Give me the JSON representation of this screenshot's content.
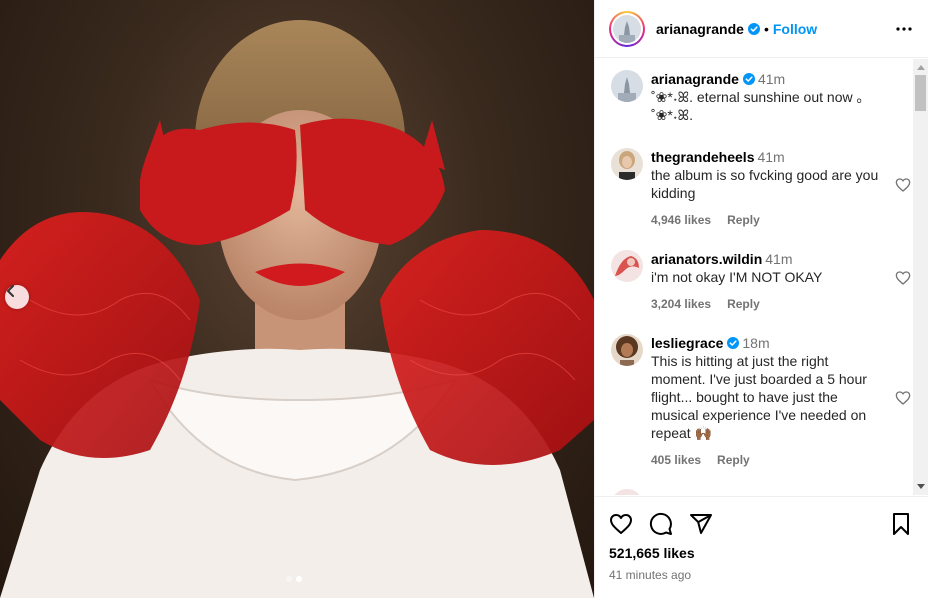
{
  "post": {
    "author": "arianagrande",
    "follow_label": "Follow",
    "separator": "•",
    "caption_time": "41m",
    "caption_text": "˚❀*˖ꕤ. eternal sunshine out now ｡ ˚❀*˖ꕤ.",
    "likes": "521,665 likes",
    "posted": "41 minutes ago"
  },
  "media": {
    "image_count": 2,
    "active_index": 1
  },
  "comments": [
    {
      "user": "thegrandeheels",
      "time": "41m",
      "text": "the album is so fvcking good are you kidding",
      "likes": "4,946 likes",
      "reply": "Reply",
      "verified": false
    },
    {
      "user": "arianators.wildin",
      "time": "41m",
      "text": "i'm not okay I'M NOT OKAY",
      "likes": "3,204 likes",
      "reply": "Reply",
      "verified": false
    },
    {
      "user": "lesliegrace",
      "time": "18m",
      "text": "This is hitting at just the right moment. I've just boarded a 5 hour flight... bought to have just the musical experience I've needed on repeat 🙌🏾",
      "likes": "405 likes",
      "reply": "Reply",
      "verified": true
    }
  ],
  "icons": {
    "prev": "chevron-left-icon",
    "more": "more-icon",
    "verified": "verified-badge-icon",
    "heart": "heart-icon",
    "comment": "comment-icon",
    "share": "share-icon",
    "save": "bookmark-icon"
  },
  "colors": {
    "link": "#0095f6",
    "verified": "#0095f6",
    "muted": "#737373"
  }
}
